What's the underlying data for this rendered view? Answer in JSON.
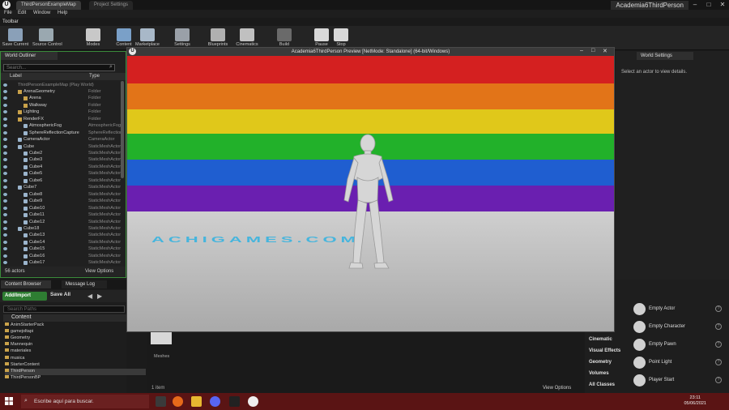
{
  "title_bar": {
    "tabs": [
      "ThirdPersonExampleMap",
      "Project Settings"
    ],
    "project_name": "Academia6ThirdPerson"
  },
  "menu": [
    "File",
    "Edit",
    "Window",
    "Help"
  ],
  "toolbar_tab": "Toolbar",
  "toolbar": [
    {
      "label": "Save Current",
      "color": "#8aa0b8"
    },
    {
      "label": "Source Control",
      "color": "#9aa8b0"
    },
    {
      "label": "Modes",
      "color": "#c8c8c8"
    },
    {
      "label": "Content",
      "color": "#7aa0c8"
    },
    {
      "label": "Marketplace",
      "color": "#a8b8c8"
    },
    {
      "label": "Settings",
      "color": "#9aa0a8"
    },
    {
      "label": "Blueprints",
      "color": "#b0b0b0"
    },
    {
      "label": "Cinematics",
      "color": "#c0c0c0"
    },
    {
      "label": "Build",
      "color": "#6a6a6a"
    },
    {
      "label": "Pause",
      "color": "#d8d8d8"
    },
    {
      "label": "Stop",
      "color": "#d8d8d8"
    }
  ],
  "outliner": {
    "tab": "World Outliner",
    "search_placeholder": "Search...",
    "col_label": "Label",
    "col_type": "Type",
    "rows": [
      {
        "name": "ThirdPersonExampleMap (Play World)",
        "type": "",
        "indent": 0,
        "kind": "world"
      },
      {
        "name": "ArenaGeometry",
        "type": "Folder",
        "indent": 1,
        "kind": "folder"
      },
      {
        "name": "Arena",
        "type": "Folder",
        "indent": 2,
        "kind": "folder"
      },
      {
        "name": "Walkway",
        "type": "Folder",
        "indent": 2,
        "kind": "folder"
      },
      {
        "name": "Lighting",
        "type": "Folder",
        "indent": 1,
        "kind": "folder"
      },
      {
        "name": "RenderFX",
        "type": "Folder",
        "indent": 1,
        "kind": "folder"
      },
      {
        "name": "AtmosphericFog",
        "type": "AtmosphericFog",
        "indent": 2,
        "kind": "actor"
      },
      {
        "name": "SphereReflectionCapture",
        "type": "SphereReflection",
        "indent": 2,
        "kind": "actor"
      },
      {
        "name": "CameraActor",
        "type": "CameraActor",
        "indent": 1,
        "kind": "actor"
      },
      {
        "name": "Cube",
        "type": "StaticMeshActor",
        "indent": 1,
        "kind": "actor"
      },
      {
        "name": "Cube2",
        "type": "StaticMeshActor",
        "indent": 2,
        "kind": "actor"
      },
      {
        "name": "Cube3",
        "type": "StaticMeshActor",
        "indent": 2,
        "kind": "actor"
      },
      {
        "name": "Cube4",
        "type": "StaticMeshActor",
        "indent": 2,
        "kind": "actor"
      },
      {
        "name": "Cube5",
        "type": "StaticMeshActor",
        "indent": 2,
        "kind": "actor"
      },
      {
        "name": "Cube6",
        "type": "StaticMeshActor",
        "indent": 2,
        "kind": "actor"
      },
      {
        "name": "Cube7",
        "type": "StaticMeshActor",
        "indent": 1,
        "kind": "actor"
      },
      {
        "name": "Cube8",
        "type": "StaticMeshActor",
        "indent": 2,
        "kind": "actor"
      },
      {
        "name": "Cube9",
        "type": "StaticMeshActor",
        "indent": 2,
        "kind": "actor"
      },
      {
        "name": "Cube10",
        "type": "StaticMeshActor",
        "indent": 2,
        "kind": "actor"
      },
      {
        "name": "Cube11",
        "type": "StaticMeshActor",
        "indent": 2,
        "kind": "actor"
      },
      {
        "name": "Cube12",
        "type": "StaticMeshActor",
        "indent": 2,
        "kind": "actor"
      },
      {
        "name": "Cube18",
        "type": "StaticMeshActor",
        "indent": 1,
        "kind": "actor"
      },
      {
        "name": "Cube13",
        "type": "StaticMeshActor",
        "indent": 2,
        "kind": "actor"
      },
      {
        "name": "Cube14",
        "type": "StaticMeshActor",
        "indent": 2,
        "kind": "actor"
      },
      {
        "name": "Cube15",
        "type": "StaticMeshActor",
        "indent": 2,
        "kind": "actor"
      },
      {
        "name": "Cube16",
        "type": "StaticMeshActor",
        "indent": 2,
        "kind": "actor"
      },
      {
        "name": "Cube17",
        "type": "StaticMeshActor",
        "indent": 2,
        "kind": "actor"
      }
    ],
    "actor_count": "56 actors",
    "view_options": "View Options"
  },
  "content_browser": {
    "tabs": [
      "Content Browser",
      "Message Log"
    ],
    "add_import": "Add/Import",
    "save_all": "Save All",
    "search_placeholder": "Search Paths",
    "root": "Content",
    "folders": [
      "AnimStarterPack",
      "gamejoltapi",
      "Geometry",
      "Mannequin",
      "materiales",
      "musica",
      "StarterContent",
      "ThirdPerson",
      "ThirdPersonBP"
    ],
    "asset_label": "Meshes",
    "item_count": "1 item",
    "view_options": "View Options"
  },
  "world_settings": {
    "tab": "World Settings",
    "hint": "Select an actor to view details."
  },
  "place_actors": {
    "categories": [
      "Cinematic",
      "Visual Effects",
      "Geometry",
      "Volumes",
      "All Classes"
    ],
    "items": [
      "Empty Actor",
      "Empty Character",
      "Empty Pawn",
      "Point Light",
      "Player Start"
    ]
  },
  "preview": {
    "title": "Academia6ThirdPerson Preview [NetMode: Standalone]  (64-bit/Windows)",
    "floor_text": "ACHIGAMES.COM",
    "stripes": [
      "#d42020",
      "#e27418",
      "#e0c81a",
      "#22b12a",
      "#1f5ed0",
      "#6a1fb0"
    ]
  },
  "taskbar": {
    "search_placeholder": "Escribe aquí para buscar.",
    "time": "23:11",
    "date": "05/06/2021"
  }
}
